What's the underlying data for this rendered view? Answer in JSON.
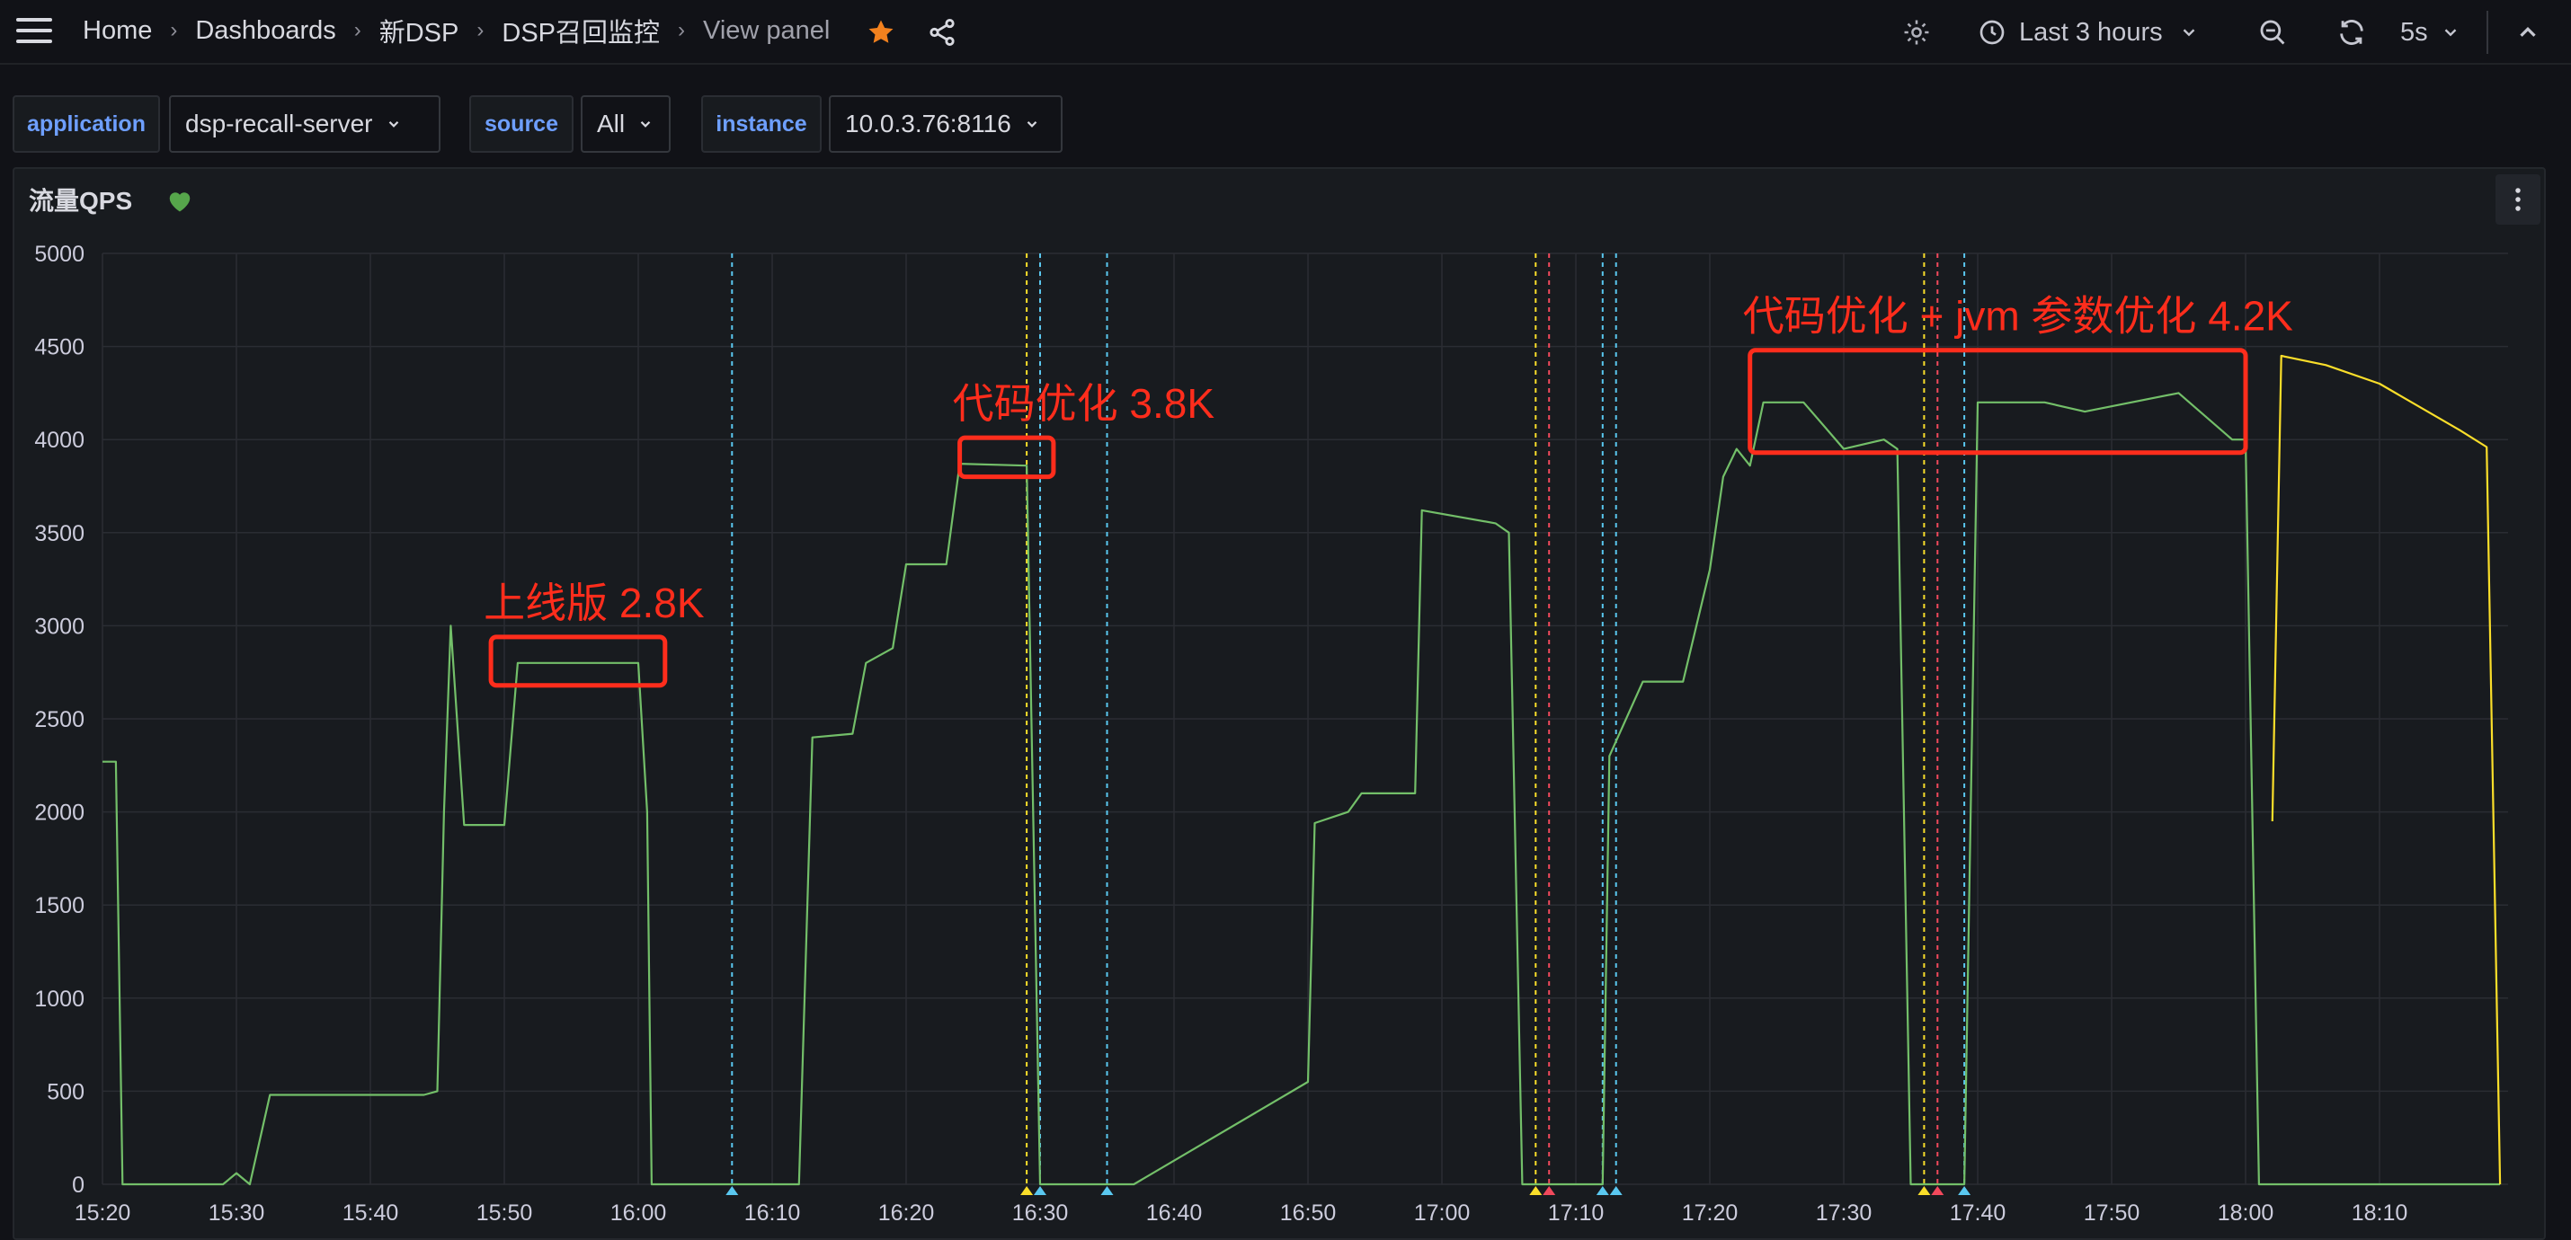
{
  "breadcrumb": {
    "items": [
      "Home",
      "Dashboards",
      "新DSP",
      "DSP召回监控"
    ],
    "current": "View panel",
    "separator": "›"
  },
  "toolbar": {
    "time_range": "Last 3 hours",
    "refresh_interval": "5s"
  },
  "variables": [
    {
      "label": "application",
      "value": "dsp-recall-server"
    },
    {
      "label": "source",
      "value": "All"
    },
    {
      "label": "instance",
      "value": "10.0.3.76:8116"
    }
  ],
  "panel": {
    "title": "流量QPS",
    "health_color": "#56a64b"
  },
  "colors": {
    "background": "#111217",
    "panel": "#181b1f",
    "green_series": "#73bf69",
    "yellow_series": "#fade2a",
    "annotation_red": "#f2495c",
    "annotation_cyan": "#5ac8f0",
    "callout_red": "#ff2d1c",
    "star": "#f2811e"
  },
  "chart_data": {
    "type": "line",
    "title": "流量QPS",
    "ylim": [
      0,
      5000
    ],
    "y_ticks": [
      "0",
      "500",
      "1000",
      "1500",
      "2000",
      "2500",
      "3000",
      "3500",
      "4000",
      "4500",
      "5000"
    ],
    "x_ticks": [
      "15:20",
      "15:30",
      "15:40",
      "15:50",
      "16:00",
      "16:10",
      "16:20",
      "16:30",
      "16:40",
      "16:50",
      "17:00",
      "17:10",
      "17:20",
      "17:30",
      "17:40",
      "17:50",
      "18:00",
      "18:10"
    ],
    "grid": true,
    "series": [
      {
        "color": "#73bf69",
        "points": [
          [
            "15:20",
            2270
          ],
          [
            "15:21",
            2270
          ],
          [
            "15:21:30",
            0
          ],
          [
            "15:22",
            0
          ],
          [
            "15:29",
            0
          ],
          [
            "15:30",
            60
          ],
          [
            "15:31",
            0
          ],
          [
            "15:32:30",
            480
          ],
          [
            "15:44",
            480
          ],
          [
            "15:45",
            500
          ],
          [
            "15:45:30",
            2000
          ],
          [
            "15:46",
            3000
          ],
          [
            "15:47",
            1930
          ],
          [
            "15:50",
            1930
          ],
          [
            "15:51",
            2800
          ],
          [
            "16:00",
            2800
          ],
          [
            "16:00:40",
            2000
          ],
          [
            "16:01",
            0
          ],
          [
            "16:02",
            0
          ],
          [
            "16:12",
            0
          ],
          [
            "16:13",
            2400
          ],
          [
            "16:16",
            2420
          ],
          [
            "16:17",
            2800
          ],
          [
            "16:19",
            2880
          ],
          [
            "16:20",
            3330
          ],
          [
            "16:23",
            3330
          ],
          [
            "16:24",
            3870
          ],
          [
            "16:29",
            3860
          ],
          [
            "16:30",
            0
          ],
          [
            "16:37",
            0
          ],
          [
            "16:50",
            550
          ],
          [
            "16:50:30",
            1940
          ],
          [
            "16:53",
            2000
          ],
          [
            "16:54",
            2100
          ],
          [
            "16:58",
            2100
          ],
          [
            "16:58:30",
            3620
          ],
          [
            "17:04",
            3550
          ],
          [
            "17:05",
            3500
          ],
          [
            "17:06",
            0
          ],
          [
            "17:12",
            0
          ],
          [
            "17:12:30",
            2300
          ],
          [
            "17:15",
            2700
          ],
          [
            "17:18",
            2700
          ],
          [
            "17:20",
            3300
          ],
          [
            "17:21",
            3800
          ],
          [
            "17:22",
            3950
          ],
          [
            "17:23",
            3860
          ],
          [
            "17:24",
            4200
          ],
          [
            "17:27",
            4200
          ],
          [
            "17:30",
            3950
          ],
          [
            "17:33",
            4000
          ],
          [
            "17:34",
            3950
          ],
          [
            "17:35",
            0
          ],
          [
            "17:39",
            0
          ],
          [
            "17:40",
            4200
          ],
          [
            "17:45",
            4200
          ],
          [
            "17:48",
            4150
          ],
          [
            "17:55",
            4250
          ],
          [
            "17:59",
            4000
          ],
          [
            "18:00",
            4000
          ],
          [
            "18:01",
            0
          ],
          [
            "18:19",
            0
          ]
        ]
      },
      {
        "color": "#fade2a",
        "points": [
          [
            "18:02",
            1950
          ],
          [
            "18:02:40",
            4450
          ],
          [
            "18:06",
            4400
          ],
          [
            "18:10",
            4300
          ],
          [
            "18:16",
            4050
          ],
          [
            "18:18",
            3960
          ],
          [
            "18:19",
            0
          ]
        ]
      }
    ],
    "annotations": [
      {
        "time": "16:07",
        "color": "#5ac8f0"
      },
      {
        "time": "16:29",
        "color": "#fade2a"
      },
      {
        "time": "16:30",
        "color": "#5ac8f0"
      },
      {
        "time": "16:35",
        "color": "#5ac8f0"
      },
      {
        "time": "17:07",
        "color": "#fade2a"
      },
      {
        "time": "17:08",
        "color": "#f2495c"
      },
      {
        "time": "17:12",
        "color": "#5ac8f0"
      },
      {
        "time": "17:13",
        "color": "#5ac8f0"
      },
      {
        "time": "17:36",
        "color": "#fade2a"
      },
      {
        "time": "17:37",
        "color": "#f2495c"
      },
      {
        "time": "17:39",
        "color": "#5ac8f0"
      }
    ],
    "callouts": [
      {
        "text": "上线版 2.8K",
        "from": "15:49",
        "to": "16:02",
        "low": 2680,
        "high": 2940
      },
      {
        "text": "代码优化 3.8K",
        "from": "16:24",
        "to": "16:31",
        "low": 3800,
        "high": 4010
      },
      {
        "text": "代码优化 + jvm 参数优化 4.2K",
        "from": "17:23",
        "to": "18:00",
        "low": 3930,
        "high": 4480
      }
    ]
  }
}
